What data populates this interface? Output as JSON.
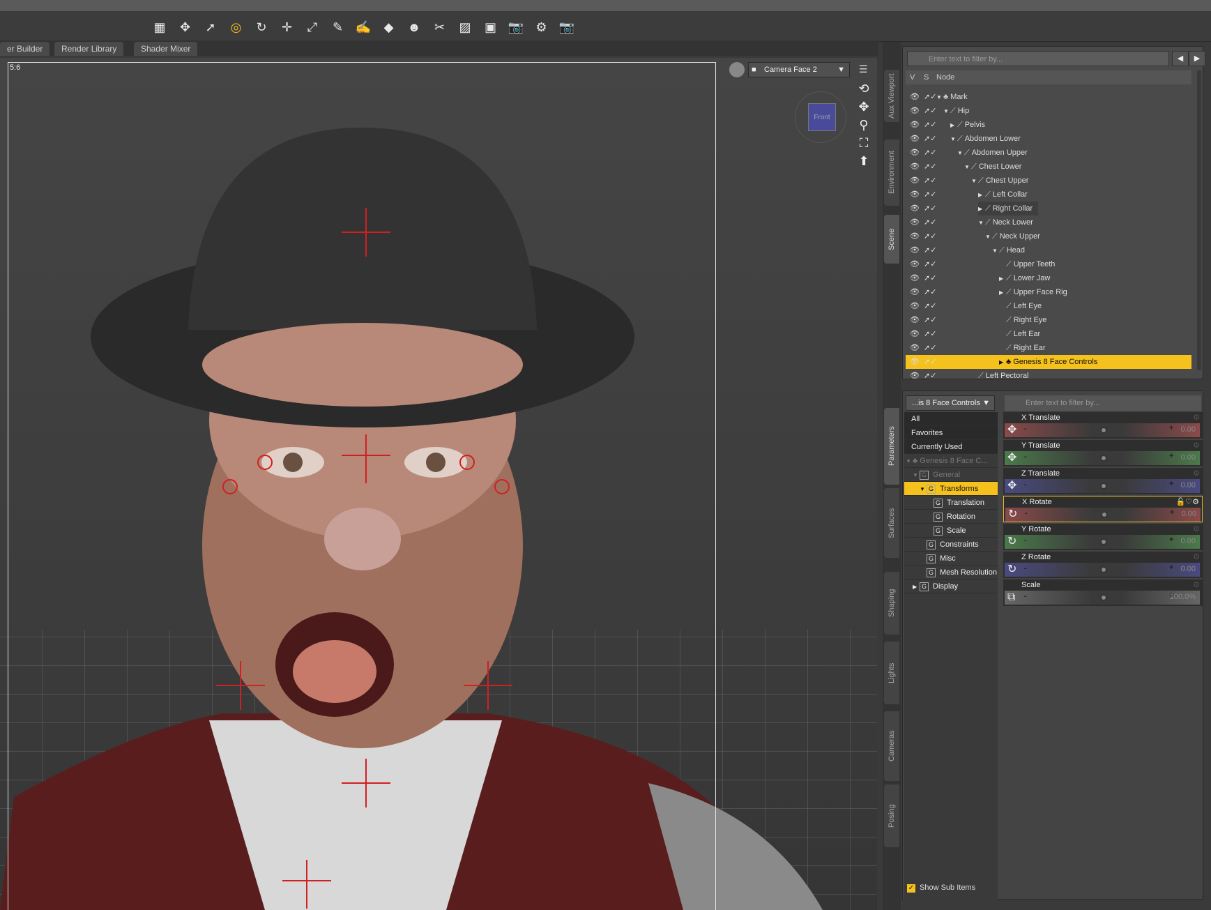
{
  "toolbar": {
    "icons": [
      "grid-icon",
      "universal-tool-icon",
      "select-icon",
      "node-select-icon",
      "rotate-icon",
      "translate-icon",
      "scale-icon",
      "joint-editor-icon",
      "geometry-editor-icon",
      "surface-selection-icon",
      "figure-setup-icon",
      "powerpose-icon",
      "active-pose-icon",
      "region-navigator-icon",
      "spot-render-icon",
      "camera-icon",
      "render-icon"
    ]
  },
  "tabs": [
    "er Builder",
    "Render Library",
    "Shader Mixer"
  ],
  "viewport": {
    "aspect_label": "5:6",
    "camera": "Camera Face 2",
    "cube_label": "Front"
  },
  "side_tabs_top": [
    "Aux Viewport",
    "Environment",
    "Scene"
  ],
  "side_tabs_bottom": [
    "Parameters",
    "Surfaces",
    "Shaping",
    "Lights",
    "Cameras",
    "Posing"
  ],
  "scene": {
    "filter_placeholder": "Enter text to filter by...",
    "columns": [
      "V",
      "S",
      "Node"
    ],
    "nodes": [
      {
        "label": "Mark",
        "depth": 0,
        "tw": "down",
        "icon": "figure"
      },
      {
        "label": "Hip",
        "depth": 1,
        "tw": "down",
        "icon": "bone"
      },
      {
        "label": "Pelvis",
        "depth": 2,
        "tw": "right",
        "icon": "bone"
      },
      {
        "label": "Abdomen Lower",
        "depth": 2,
        "tw": "down",
        "icon": "bone"
      },
      {
        "label": "Abdomen Upper",
        "depth": 3,
        "tw": "down",
        "icon": "bone"
      },
      {
        "label": "Chest Lower",
        "depth": 4,
        "tw": "down",
        "icon": "bone"
      },
      {
        "label": "Chest Upper",
        "depth": 5,
        "tw": "down",
        "icon": "bone"
      },
      {
        "label": "Left Collar",
        "depth": 6,
        "tw": "right",
        "icon": "bone"
      },
      {
        "label": "Right Collar",
        "depth": 6,
        "tw": "right",
        "icon": "bone",
        "highlight": true
      },
      {
        "label": "Neck Lower",
        "depth": 6,
        "tw": "down",
        "icon": "bone"
      },
      {
        "label": "Neck Upper",
        "depth": 7,
        "tw": "down",
        "icon": "bone"
      },
      {
        "label": "Head",
        "depth": 8,
        "tw": "down",
        "icon": "bone"
      },
      {
        "label": "Upper Teeth",
        "depth": 9,
        "tw": "",
        "icon": "bone"
      },
      {
        "label": "Lower Jaw",
        "depth": 9,
        "tw": "right",
        "icon": "bone"
      },
      {
        "label": "Upper Face Rig",
        "depth": 9,
        "tw": "right",
        "icon": "bone"
      },
      {
        "label": "Left Eye",
        "depth": 9,
        "tw": "",
        "icon": "bone"
      },
      {
        "label": "Right Eye",
        "depth": 9,
        "tw": "",
        "icon": "bone"
      },
      {
        "label": "Left Ear",
        "depth": 9,
        "tw": "",
        "icon": "bone"
      },
      {
        "label": "Right Ear",
        "depth": 9,
        "tw": "",
        "icon": "bone"
      },
      {
        "label": "Genesis 8 Face Controls",
        "depth": 9,
        "tw": "right",
        "icon": "figure",
        "selected": true
      },
      {
        "label": "Left Pectoral",
        "depth": 5,
        "tw": "",
        "icon": "bone"
      }
    ]
  },
  "parameters": {
    "node_dropdown": "...is 8 Face Controls",
    "filter_placeholder": "Enter text to filter by...",
    "groups": [
      {
        "label": "All",
        "style": "dark",
        "depth": 0
      },
      {
        "label": "Favorites",
        "style": "dark",
        "depth": 0
      },
      {
        "label": "Currently Used",
        "style": "dark",
        "depth": 0
      },
      {
        "label": "Genesis 8 Face C...",
        "style": "dim",
        "depth": 0,
        "tw": "down",
        "icon": "figure"
      },
      {
        "label": "General",
        "style": "dim",
        "depth": 1,
        "tw": "down",
        "icon": "G"
      },
      {
        "label": "Transforms",
        "style": "sel",
        "depth": 2,
        "tw": "down",
        "icon": "G"
      },
      {
        "label": "Translation",
        "depth": 4,
        "icon": "G"
      },
      {
        "label": "Rotation",
        "depth": 4,
        "icon": "G"
      },
      {
        "label": "Scale",
        "depth": 4,
        "icon": "G"
      },
      {
        "label": "Constraints",
        "depth": 3,
        "icon": "G"
      },
      {
        "label": "Misc",
        "depth": 3,
        "icon": "G"
      },
      {
        "label": "Mesh Resolution",
        "depth": 3,
        "icon": "G"
      },
      {
        "label": "Display",
        "depth": 1,
        "tw": "right",
        "icon": "G"
      }
    ],
    "sliders": [
      {
        "label": "X Translate",
        "value": "0.00",
        "color": "#8a4a4a",
        "icon": "translate"
      },
      {
        "label": "Y Translate",
        "value": "0.00",
        "color": "#4a7a4a",
        "icon": "translate"
      },
      {
        "label": "Z Translate",
        "value": "0.00",
        "color": "#4a4a80",
        "icon": "translate"
      },
      {
        "label": "X Rotate",
        "value": "0.00",
        "color": "#8a4a4a",
        "icon": "rotate",
        "active": true
      },
      {
        "label": "Y Rotate",
        "value": "0.00",
        "color": "#4a7a4a",
        "icon": "rotate"
      },
      {
        "label": "Z Rotate",
        "value": "0.00",
        "color": "#4a4a80",
        "icon": "rotate"
      },
      {
        "label": "Scale",
        "value": "100.0%",
        "color": "#666666",
        "icon": "scale"
      }
    ],
    "show_sub_items": "Show Sub Items",
    "show_sub_items_checked": true
  },
  "colors": {
    "selection": "#f5c11c",
    "panel": "#4a4a4a"
  }
}
